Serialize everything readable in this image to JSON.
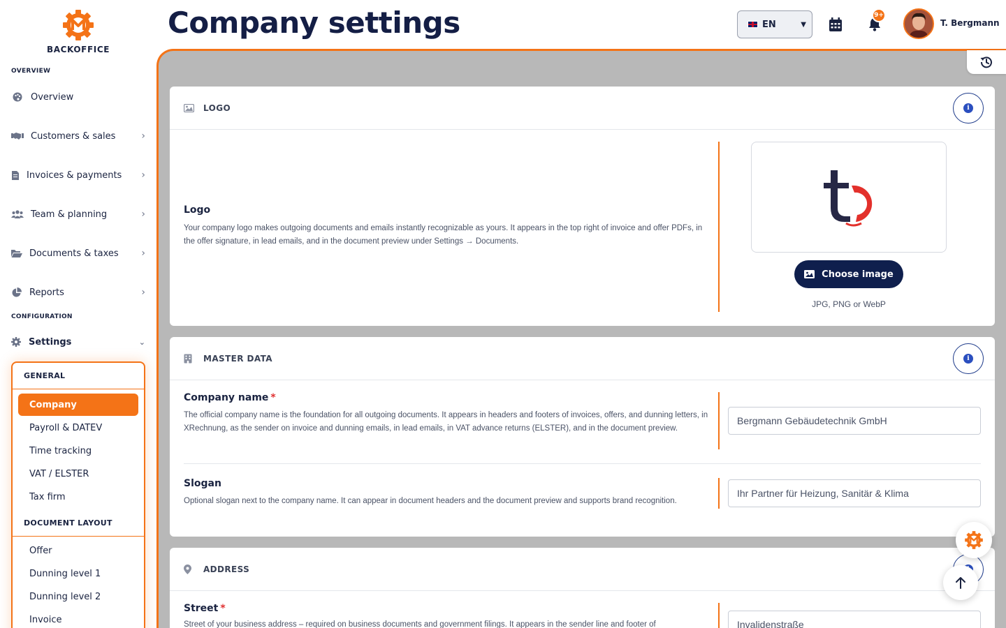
{
  "brand": {
    "name": "BACKOFFICE",
    "accent": "#f47317",
    "navy": "#141e45"
  },
  "sidebar": {
    "overview_label": "OVERVIEW",
    "configuration_label": "CONFIGURATION",
    "items": [
      {
        "label": "Overview",
        "icon": "palette-icon"
      },
      {
        "label": "Customers & sales",
        "icon": "handshake-icon"
      },
      {
        "label": "Invoices & payments",
        "icon": "invoice-icon"
      },
      {
        "label": "Team & planning",
        "icon": "users-icon"
      },
      {
        "label": "Documents & taxes",
        "icon": "folder-icon"
      },
      {
        "label": "Reports",
        "icon": "pie-chart-icon"
      }
    ],
    "settings_label": "Settings",
    "submenu": {
      "general_label": "GENERAL",
      "general_items": [
        "Company",
        "Payroll & DATEV",
        "Time tracking",
        "VAT / ELSTER",
        "Tax firm"
      ],
      "layout_label": "DOCUMENT LAYOUT",
      "layout_items": [
        "Offer",
        "Dunning level 1",
        "Dunning level 2",
        "Invoice"
      ]
    }
  },
  "header": {
    "title": "Company settings",
    "language": "EN",
    "notification_badge": "9+",
    "user_name": "T. Bergmann"
  },
  "logo_card": {
    "title": "LOGO",
    "field_label": "Logo",
    "description": "Your company logo makes outgoing documents and emails instantly recognizable as yours. It appears in the top right of invoice and offer PDFs, in the offer signature, in lead emails, and in the document preview under Settings → Documents.",
    "button_label": "Choose image",
    "hint": "JPG, PNG or WebP"
  },
  "master_card": {
    "title": "MASTER DATA",
    "company_label": "Company name",
    "company_desc": "The official company name is the foundation for all outgoing documents. It appears in headers and footers of invoices, offers, and dunning letters, in XRechnung, as the sender on invoice and dunning emails, in lead emails, in VAT advance returns (ELSTER), and in the document preview.",
    "company_value": "Bergmann Gebäudetechnik GmbH",
    "slogan_label": "Slogan",
    "slogan_desc": "Optional slogan next to the company name. It can appear in document headers and the document preview and supports brand recognition.",
    "slogan_value": "Ihr Partner für Heizung, Sanitär & Klima"
  },
  "address_card": {
    "title": "ADDRESS",
    "street_label": "Street",
    "street_desc": "Street of your business address – required on business documents and government filings. It appears in the sender line and footer of",
    "street_value": "Invalidenstraße"
  }
}
